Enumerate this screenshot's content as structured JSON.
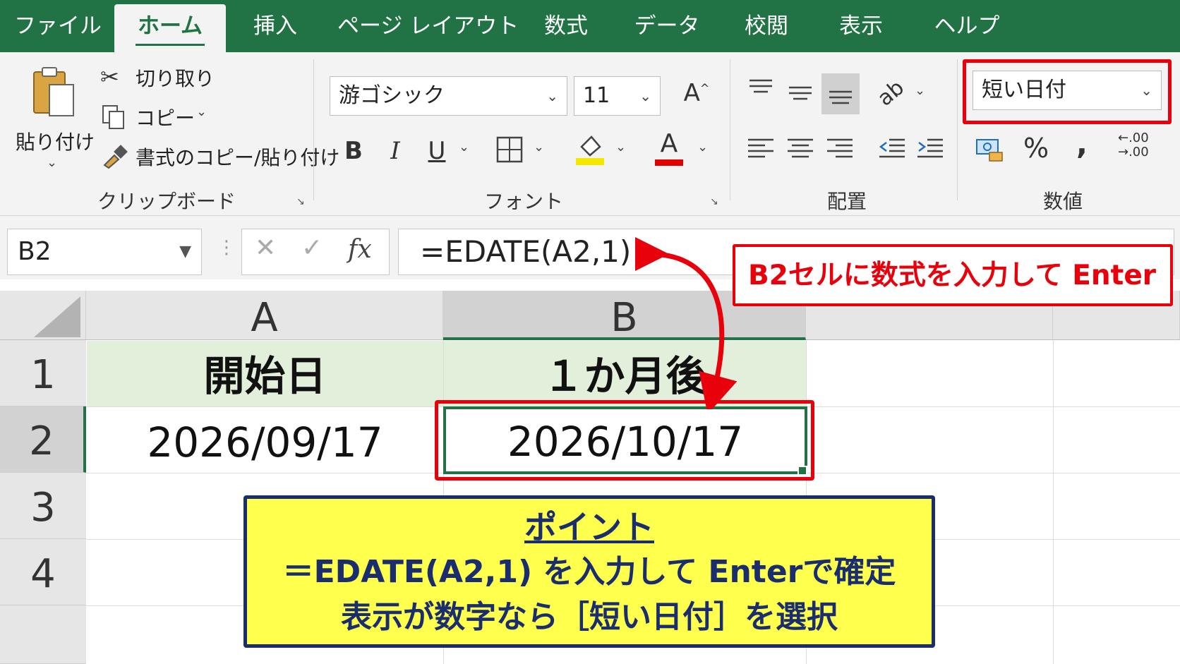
{
  "tabs": [
    "ファイル",
    "ホーム",
    "挿入",
    "ページ レイアウト",
    "数式",
    "データ",
    "校閲",
    "表示",
    "ヘルプ"
  ],
  "active_tab": "ホーム",
  "clipboard": {
    "paste_label": "貼り付け",
    "cut_label": "切り取り",
    "copy_label": "コピー",
    "format_painter_label": "書式のコピー/貼り付け",
    "group_label": "クリップボード"
  },
  "font": {
    "family": "游ゴシック",
    "size": "11",
    "bold": "B",
    "italic": "I",
    "underline": "U",
    "font_color_glyph": "A",
    "grow_glyph": "A",
    "group_label": "フォント",
    "highlight_color": "#f5e800",
    "font_color": "#e00000"
  },
  "alignment": {
    "group_label": "配置"
  },
  "number": {
    "format": "短い日付",
    "percent": "%",
    "comma": ",",
    "group_label": "数値"
  },
  "formula_bar": {
    "name_box": "B2",
    "fx": "fx",
    "formula": "=EDATE(A2,1)"
  },
  "grid": {
    "columns": [
      "A",
      "B"
    ],
    "rows": [
      "1",
      "2",
      "3",
      "4"
    ],
    "cells": {
      "A1": "開始日",
      "B1": "１か月後",
      "A2": "2026/09/17",
      "B2": "2026/10/17"
    },
    "header_fill": "#e2efda"
  },
  "annotations": {
    "red_callout": "B2セルに数式を入力して Enter",
    "point_title": "ポイント",
    "point_line1": "＝EDATE(A2,1) を入力して Enterで確定",
    "point_line2": "表示が数字なら［短い日付］を選択"
  },
  "colors": {
    "excel_green": "#217346",
    "highlight_red": "#e8000b",
    "point_yellow": "#ffff4d",
    "point_navy": "#1a2d6e"
  }
}
